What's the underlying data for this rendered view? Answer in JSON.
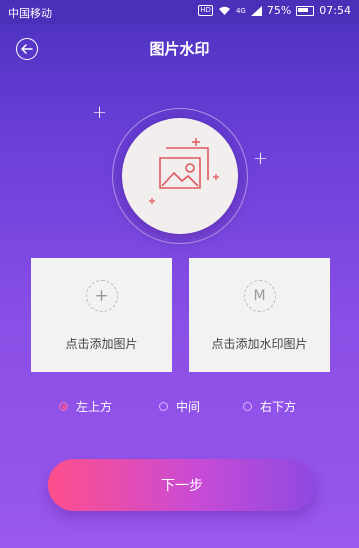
{
  "status_bar": {
    "carrier": "中国移动",
    "hd": "HD",
    "network": "4G",
    "battery": "75%",
    "time": "07:54"
  },
  "header": {
    "title": "图片水印",
    "back_icon": "back-arrow-icon"
  },
  "hero": {
    "icon": "image-placeholder-icon"
  },
  "cards": [
    {
      "label": "点击添加图片",
      "icon": "plus-icon",
      "glyph": "+"
    },
    {
      "label": "点击添加水印图片",
      "icon": "watermark-m-icon",
      "glyph": "M"
    }
  ],
  "position_options": [
    {
      "label": "左上方",
      "selected": true
    },
    {
      "label": "中间",
      "selected": false
    },
    {
      "label": "右下方",
      "selected": false
    }
  ],
  "next_button": {
    "label": "下一步"
  },
  "colors": {
    "accent_pink": "#ff4f8b",
    "background_purple": "#6a3fd8",
    "icon_red": "#e0585d"
  }
}
